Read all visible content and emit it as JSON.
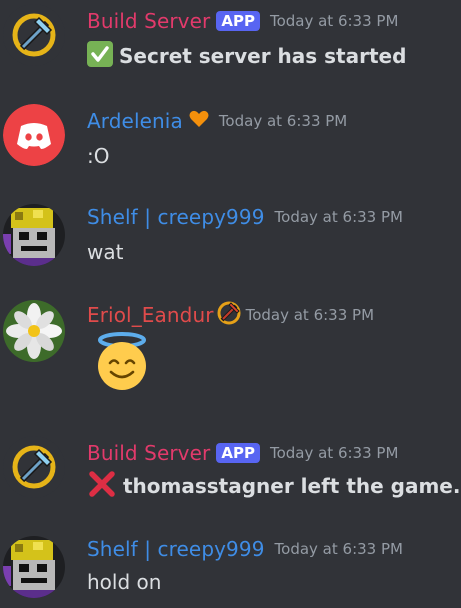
{
  "messages": [
    {
      "author": "Build Server",
      "author_color": "#e23a6b",
      "badge": "APP",
      "timestamp": "Today at 6:33 PM",
      "content": "Secret server has started",
      "content_icon": "check-mark-icon",
      "avatar_icon": "blue-pickaxe-ring-icon"
    },
    {
      "author": "Ardelenia",
      "author_color": "#3f8de6",
      "author_icon": "orange-heart-icon",
      "timestamp": "Today at 6:33 PM",
      "content": ":O",
      "avatar_icon": "discord-logo-icon"
    },
    {
      "author": "Shelf | creepy999",
      "author_color": "#3f8de6",
      "timestamp": "Today at 6:33 PM",
      "content": "wat",
      "avatar_icon": "pixel-character-avatar"
    },
    {
      "author": "Eriol_Eandur",
      "author_color": "#e04b4b",
      "author_icon": "red-pickaxe-ring-icon",
      "timestamp": "Today at 6:33 PM",
      "content_icon": "smiling-face-with-halo-emoji",
      "avatar_icon": "white-flower-avatar"
    },
    {
      "author": "Build Server",
      "author_color": "#e23a6b",
      "badge": "APP",
      "timestamp": "Today at 6:33 PM",
      "content": "thomasstagner left the game.",
      "content_icon": "cross-mark-icon",
      "avatar_icon": "blue-pickaxe-ring-icon"
    },
    {
      "author": "Shelf | creepy999",
      "author_color": "#3f8de6",
      "timestamp": "Today at 6:33 PM",
      "content": "hold on",
      "avatar_icon": "pixel-character-avatar"
    }
  ]
}
